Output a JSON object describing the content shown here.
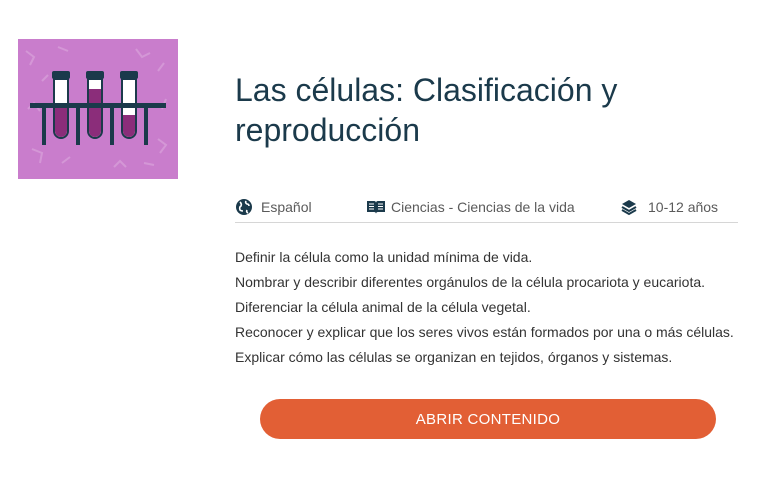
{
  "thumbnail": {
    "icon": "test-tubes-icon",
    "background_color": "#c97dcc",
    "liquid_color": "#8b2d7a",
    "rack_color": "#1b3a4b"
  },
  "title": "Las células: Clasificación y reproducción",
  "meta": {
    "language": {
      "icon": "globe-icon",
      "label": "Español"
    },
    "subject": {
      "icon": "book-icon",
      "label": "Ciencias - Ciencias de la vida"
    },
    "age": {
      "icon": "layers-icon",
      "label": "10-12 años"
    }
  },
  "objectives": [
    "Definir la célula como la unidad mínima de vida.",
    "Nombrar y describir diferentes orgánulos de la célula procariota y eucariota.",
    "Diferenciar la célula animal de la célula vegetal.",
    "Reconocer y explicar que los seres vivos están formados por una o más células.",
    "Explicar cómo las células se organizan en tejidos, órganos y sistemas."
  ],
  "button": {
    "label": "ABRIR CONTENIDO",
    "color": "#e25f35"
  }
}
